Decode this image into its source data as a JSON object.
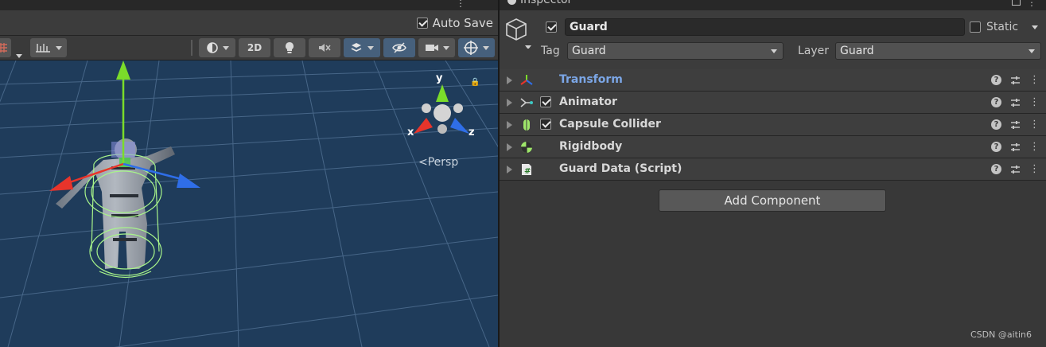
{
  "scene": {
    "autosave_label": "Auto Save",
    "toolbar": {
      "mode_2d_label": "2D"
    },
    "gizmo": {
      "axis_x": "x",
      "axis_y": "y",
      "axis_z": "z",
      "projection_label": "Persp"
    }
  },
  "inspector": {
    "tab_label": "Inspector",
    "gameobject": {
      "name": "Guard",
      "static_label": "Static",
      "tag_label": "Tag",
      "tag_value": "Guard",
      "layer_label": "Layer",
      "layer_value": "Guard"
    },
    "components": [
      {
        "name": "Transform",
        "icon": "transform-icon",
        "has_toggle": false
      },
      {
        "name": "Animator",
        "icon": "animator-icon",
        "has_toggle": true
      },
      {
        "name": "Capsule Collider",
        "icon": "capsule-collider-icon",
        "has_toggle": true
      },
      {
        "name": "Rigidbody",
        "icon": "rigidbody-icon",
        "has_toggle": false
      },
      {
        "name": "Guard Data (Script)",
        "icon": "script-icon",
        "has_toggle": false
      }
    ],
    "add_component_label": "Add Component"
  },
  "watermark": "CSDN @aitin6",
  "colors": {
    "viewport_bg": "#1f3c5b",
    "axis_x": "#e8342b",
    "axis_y": "#7bdc2a",
    "axis_z": "#2f6ee8",
    "collider": "#a8f58a",
    "transform_label": "#7ba6e6"
  }
}
